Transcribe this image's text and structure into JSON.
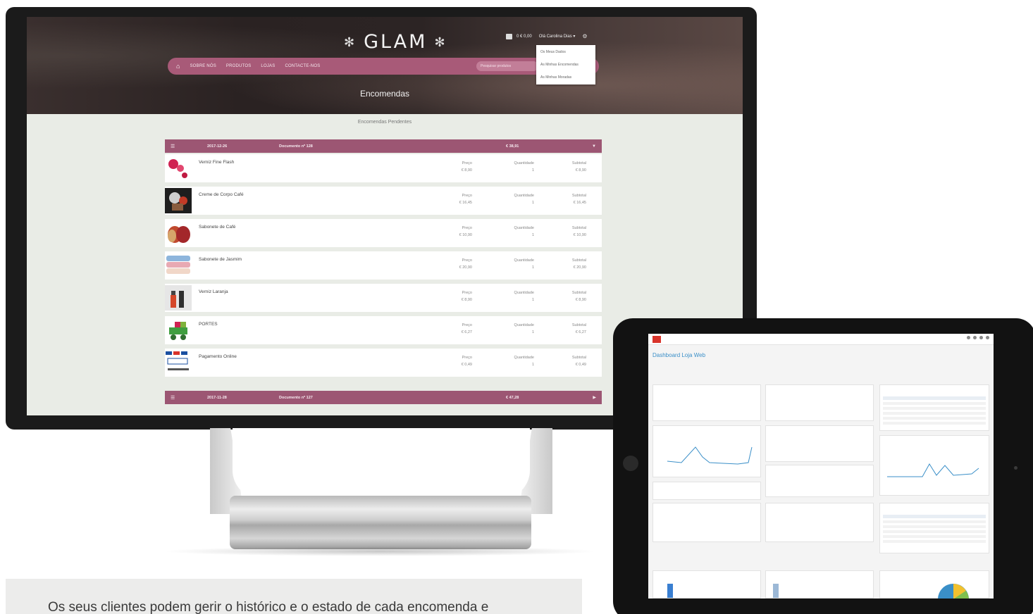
{
  "store": {
    "logo": "GLAM",
    "cart": "0 € 0,00",
    "user_menu": "Olá Carolina Dias ▾",
    "user_dropdown": [
      "Os Meus Dados",
      "As Minhas Encomendas",
      "As Minhas Moradas"
    ],
    "nav": [
      "SOBRE NÓS",
      "PRODUTOS",
      "LOJAS",
      "CONTACTE-NOS"
    ],
    "search_placeholder": "Pesquisar produtos",
    "page_title": "Encomendas",
    "section_title": "Encomendas Pendentes"
  },
  "orders": [
    {
      "date": "2017-12-26",
      "doc": "Documento nº 128",
      "total": "€ 38,91",
      "expanded": true
    },
    {
      "date": "2017-11-28",
      "doc": "Documento nº 127",
      "total": "€ 47,28",
      "expanded": false
    }
  ],
  "columns": {
    "price": "Preço",
    "qty": "Quantidade",
    "subtotal": "Subtotal"
  },
  "items": [
    {
      "name": "Verniz Fine Flash",
      "price": "€ 8,90",
      "qty": "1",
      "subtotal": "€ 8,90",
      "thumb_color": "#c8204a"
    },
    {
      "name": "Creme de Corpo Café",
      "price": "€ 16,45",
      "qty": "1",
      "subtotal": "€ 16,45",
      "thumb_color": "#7a2a1f"
    },
    {
      "name": "Sabonete de Café",
      "price": "€ 10,90",
      "qty": "1",
      "subtotal": "€ 10,90",
      "thumb_color": "#b5432c"
    },
    {
      "name": "Sabonete de Jasmim",
      "price": "€ 20,90",
      "qty": "1",
      "subtotal": "€ 20,90",
      "thumb_color": "#8fb2d4"
    },
    {
      "name": "Verniz Laranja",
      "price": "€ 8,90",
      "qty": "1",
      "subtotal": "€ 8,90",
      "thumb_color": "#d2532f"
    },
    {
      "name": "PORTES",
      "price": "€ 6,27",
      "qty": "1",
      "subtotal": "€ 6,27",
      "thumb_color": "#2e8a3c"
    },
    {
      "name": "Pagamento Online",
      "price": "€ 0,49",
      "qty": "1",
      "subtotal": "€ 0,49",
      "thumb_color": "#1f4e8f"
    }
  ],
  "dashboard": {
    "title": "Dashboard Loja Web"
  },
  "caption": "Os seus clientes podem gerir o histórico e o estado de cada encomenda e"
}
